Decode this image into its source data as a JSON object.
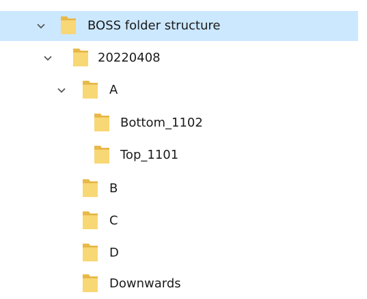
{
  "tree": {
    "items": [
      {
        "label": "BOSS folder structure",
        "level": 0,
        "expanded": true,
        "selected": true,
        "icon": "folder-icon"
      },
      {
        "label": "20220408",
        "level": 1,
        "expanded": true,
        "selected": false,
        "icon": "folder-icon"
      },
      {
        "label": "A",
        "level": 2,
        "expanded": true,
        "selected": false,
        "icon": "folder-icon"
      },
      {
        "label": "Bottom_1102",
        "level": 3,
        "expanded": false,
        "selected": false,
        "icon": "folder-icon"
      },
      {
        "label": "Top_1101",
        "level": 3,
        "expanded": false,
        "selected": false,
        "icon": "folder-icon"
      },
      {
        "label": "B",
        "level": 2,
        "expanded": false,
        "selected": false,
        "icon": "folder-icon"
      },
      {
        "label": "C",
        "level": 2,
        "expanded": false,
        "selected": false,
        "icon": "folder-icon"
      },
      {
        "label": "D",
        "level": 2,
        "expanded": false,
        "selected": false,
        "icon": "folder-icon"
      },
      {
        "label": "Downwards",
        "level": 2,
        "expanded": false,
        "selected": false,
        "icon": "folder-icon"
      }
    ]
  },
  "colors": {
    "selection": "#cce8ff",
    "folder_fill": "#f8d775",
    "folder_back": "#e9b949",
    "chevron": "#555555"
  }
}
